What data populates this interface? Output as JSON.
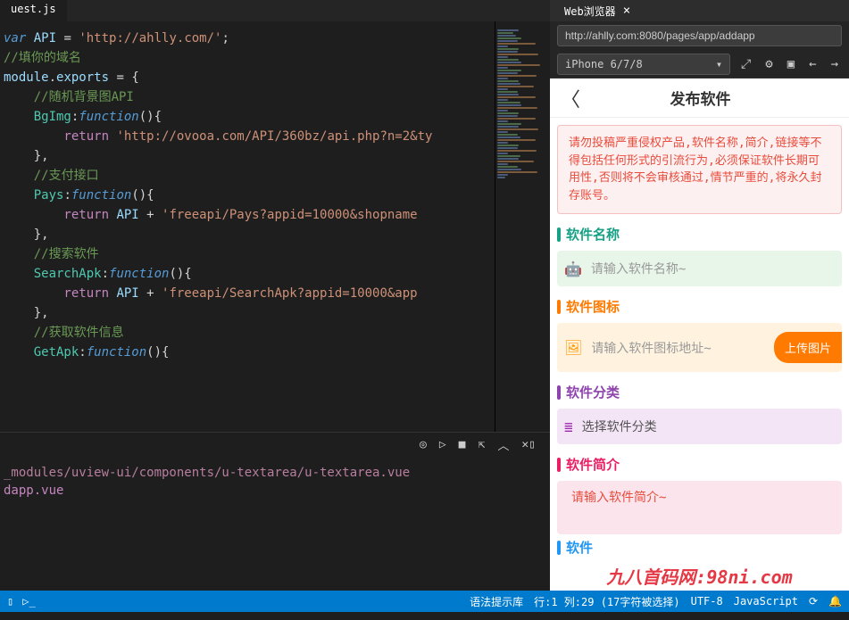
{
  "editor": {
    "tab": "uest.js",
    "code": {
      "l1_var": "var",
      "l1_api": " API ",
      "l1_eq": "= ",
      "l1_str": "'http://ahlly.com/'",
      "l1_semi": ";",
      "l2": "//填你的域名",
      "l3_mod": "module",
      "l3_dot": ".",
      "l3_exp": "exports",
      "l3_eq": " = {",
      "l4": "    //随机背景图API",
      "l5_prop": "    BgImg",
      "l5_colon": ":",
      "l5_func": "function",
      "l5_paren": "(){",
      "l6_ret": "        return ",
      "l6_str": "'http://ovooa.com/API/360bz/api.php?n=2&ty",
      "l7": "    },",
      "l8": "    //支付接口",
      "l9_prop": "    Pays",
      "l9_colon": ":",
      "l9_func": "function",
      "l9_paren": "(){",
      "l10_ret": "        return ",
      "l10_api": "API ",
      "l10_plus": "+ ",
      "l10_str": "'freeapi/Pays?appid=10000&shopname",
      "l11": "    },",
      "l12": "    //搜索软件",
      "l13_prop": "    SearchApk",
      "l13_colon": ":",
      "l13_func": "function",
      "l13_paren": "(){",
      "l14_ret": "        return ",
      "l14_api": "API ",
      "l14_plus": "+ ",
      "l14_str": "'freeapi/SearchApk?appid=10000&app",
      "l15": "    },",
      "l16": "    //获取软件信息",
      "l17_prop": "    GetApk",
      "l17_colon": ":",
      "l17_func": "function",
      "l17_paren": "(){"
    },
    "console": {
      "l1": "_modules/uview-ui/components/u-textarea/u-textarea.vue",
      "l2": "dapp.vue"
    }
  },
  "browser": {
    "tab_label": "Web浏览器",
    "url": "http://ahlly.com:8080/pages/app/addapp",
    "device": "iPhone 6/7/8"
  },
  "mobile": {
    "title": "发布软件",
    "warning": "请勿投稿严重侵权产品,软件名称,简介,链接等不得包括任何形式的引流行为,必须保证软件长期可用性,否则将不会审核通过,情节严重的,将永久封存账号。",
    "sections": {
      "name": {
        "title": "软件名称",
        "placeholder": "请输入软件名称~",
        "color": "#16a085",
        "bar_color": "#16a085"
      },
      "icon": {
        "title": "软件图标",
        "placeholder": "请输入软件图标地址~",
        "upload": "上传图片",
        "color": "#ff7a00",
        "bar_color": "#ff7a00"
      },
      "category": {
        "title": "软件分类",
        "placeholder": "选择软件分类",
        "color": "#8e44ad",
        "bar_color": "#8e44ad"
      },
      "brief": {
        "title": "软件简介",
        "placeholder": "请输入软件简介~",
        "color": "#e91e63",
        "bar_color": "#e91e63"
      },
      "next": {
        "title": "软件",
        "color": "#2196f3"
      }
    },
    "watermark": "九八首码网:98ni.com"
  },
  "status": {
    "syntax": "语法提示库",
    "position": "行:1 列:29 (17字符被选择)",
    "encoding": "UTF-8",
    "language": "JavaScript"
  }
}
